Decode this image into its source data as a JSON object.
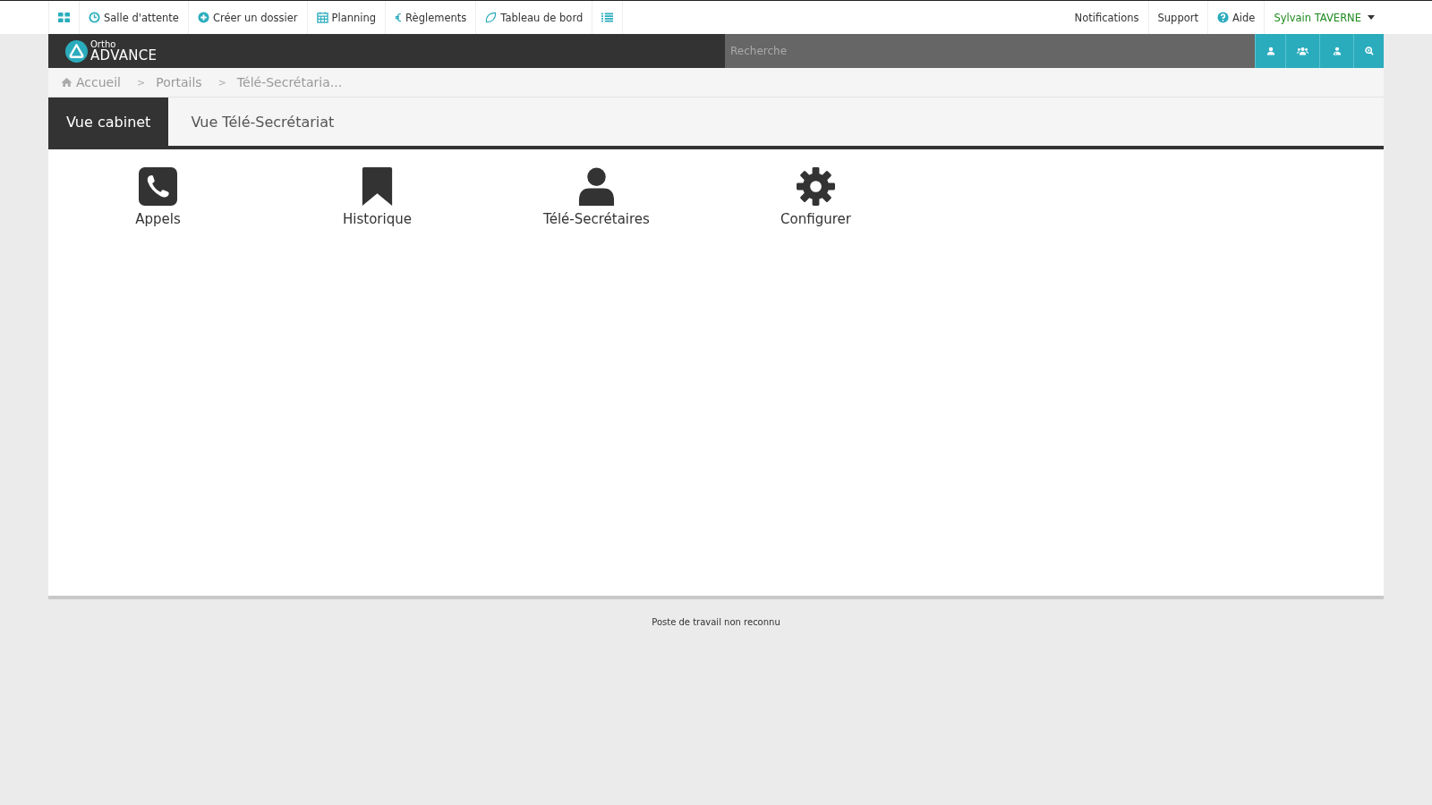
{
  "top_nav": {
    "left": [
      {
        "kind": "grid"
      },
      {
        "kind": "clock",
        "label": "Salle d'attente"
      },
      {
        "kind": "plus",
        "label": "Créer un dossier"
      },
      {
        "kind": "calendar",
        "label": "Planning"
      },
      {
        "kind": "euro",
        "label": "Règlements"
      },
      {
        "kind": "leaf",
        "label": "Tableau de bord"
      },
      {
        "kind": "list"
      }
    ],
    "right": [
      {
        "label": "Notifications",
        "kind": "text"
      },
      {
        "label": "Support",
        "kind": "text"
      },
      {
        "label": "Aide",
        "kind": "help"
      },
      {
        "label": "Sylvain TAVERNE",
        "kind": "user"
      }
    ]
  },
  "brand": {
    "small": "Ortho",
    "large": "ADVANCE"
  },
  "search": {
    "placeholder": "Recherche",
    "buttons": [
      {
        "kind": "person"
      },
      {
        "kind": "group"
      },
      {
        "kind": "doctor"
      },
      {
        "kind": "zoom"
      }
    ]
  },
  "breadcrumb": [
    {
      "label": "Accueil"
    },
    {
      "separator": ">",
      "label": "Portails"
    },
    {
      "separator": ">",
      "label": "Télé-Secrétaria..."
    }
  ],
  "tabs": [
    {
      "label": "Vue cabinet",
      "selected": true
    },
    {
      "label": "Vue Télé-Secrétariat",
      "selected": false
    }
  ],
  "tiles": [
    {
      "kind": "phone",
      "label": "Appels"
    },
    {
      "kind": "bookmark",
      "label": "Historique"
    },
    {
      "kind": "user",
      "label": "Télé-Secrétaires"
    },
    {
      "kind": "gear",
      "label": "Configurer"
    }
  ],
  "footer": "Poste de travail non reconnu"
}
